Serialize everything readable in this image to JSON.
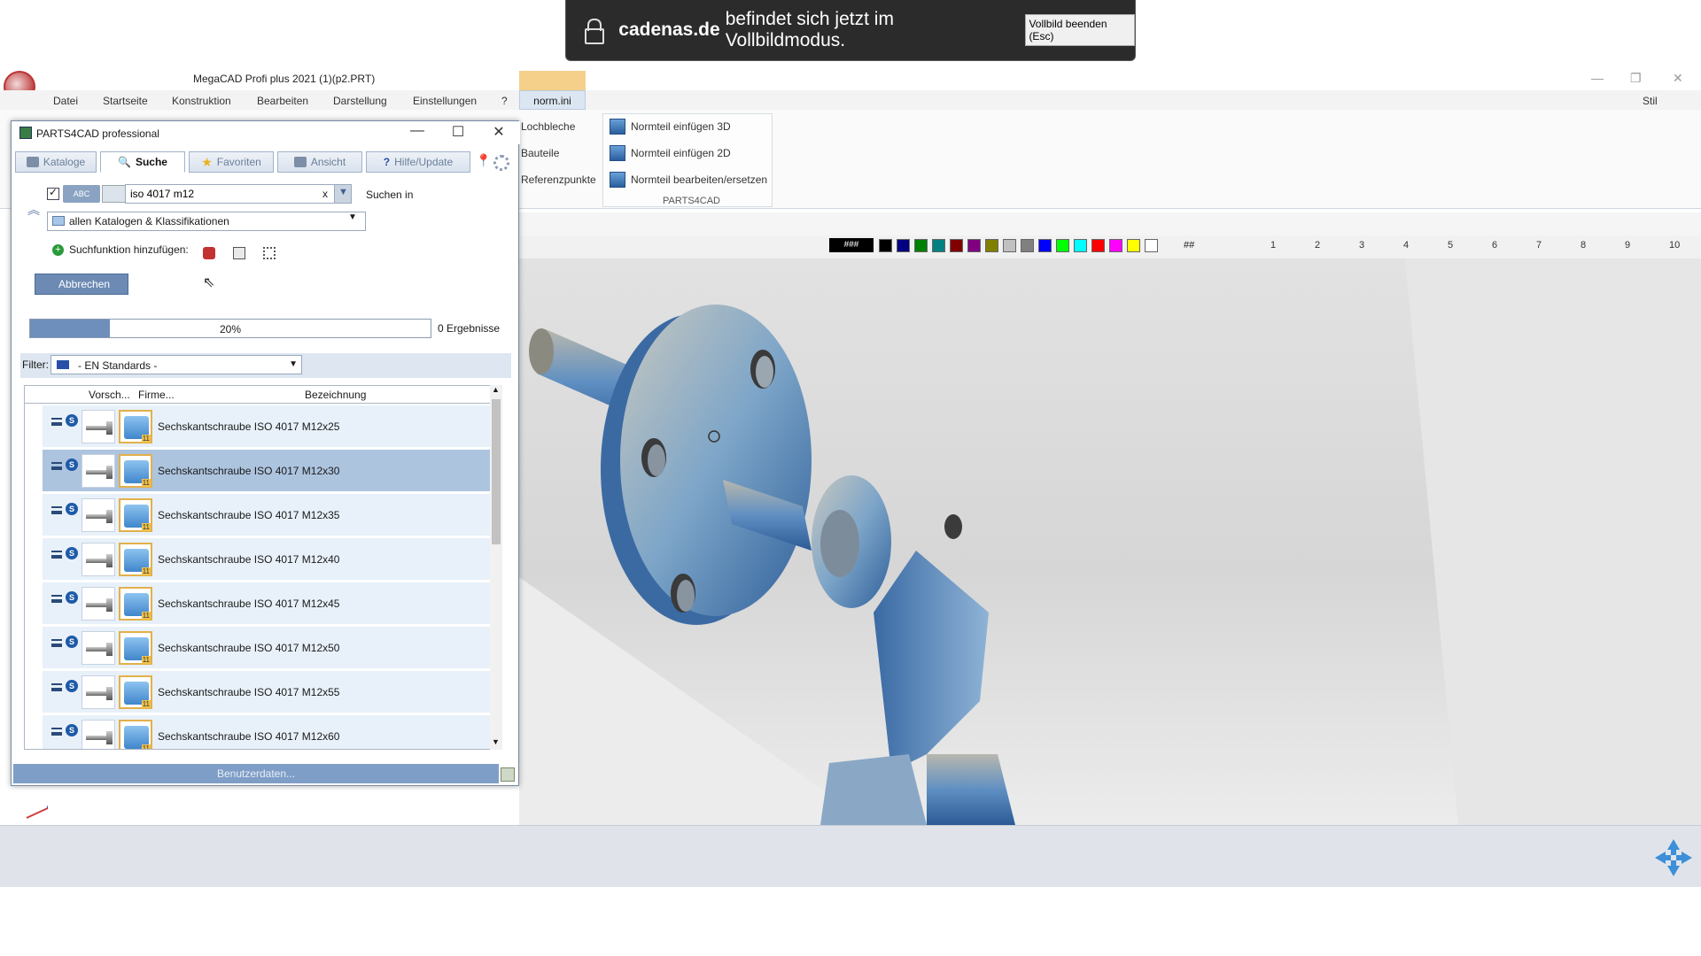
{
  "fullscreen_banner": {
    "domain": "cadenas.de",
    "message": "befindet sich jetzt im Vollbildmodus.",
    "exit_button": "Vollbild beenden (Esc)"
  },
  "app": {
    "title": "MegaCAD Profi plus 2021 (1)(p2.PRT)",
    "ribbon_tabs": [
      "Datei",
      "Startseite",
      "Konstruktion",
      "Bearbeiten",
      "Darstellung",
      "Einstellungen",
      "?",
      "norm.ini"
    ],
    "right_controls": {
      "stil": "Stil"
    },
    "ribbon_left_items": [
      "Lochbleche",
      "Bauteile",
      "Referenzpunkte"
    ],
    "parts4cad_group": {
      "items": [
        "Normteil einfügen 3D",
        "Normteil einfügen 2D",
        "Normteil bearbeiten/ersetzen"
      ],
      "group_label": "PARTS4CAD"
    },
    "toolbar_hash_label": "###",
    "toolbar_hash2": "##",
    "ruler": [
      "1",
      "2",
      "3",
      "4",
      "5",
      "6",
      "7",
      "8",
      "9",
      "10"
    ],
    "colors": [
      "#000000",
      "#000080",
      "#008000",
      "#008080",
      "#800000",
      "#800080",
      "#808000",
      "#c0c0c0",
      "#808080",
      "#0000ff",
      "#00ff00",
      "#00ffff",
      "#ff0000",
      "#ff00ff",
      "#ffff00",
      "#ffffff"
    ]
  },
  "parts4cad": {
    "title": "PARTS4CAD professional",
    "tabs": [
      "Kataloge",
      "Suche",
      "Favoriten",
      "Ansicht",
      "Hilfe/Update"
    ],
    "active_tab": "Suche",
    "abc_label": "ABC",
    "search_value": "iso 4017 m12",
    "search_clear": "x",
    "search_in_label": "Suchen in",
    "catalog_scope": "allen Katalogen & Klassifikationen",
    "add_function_label": "Suchfunktion hinzufügen:",
    "abort_button": "Abbrechen",
    "progress_label": "20%",
    "progress_fraction": 0.2,
    "results_label": "0 Ergebnisse",
    "filter_label": "Filter:",
    "filter_value": "- EN Standards -",
    "columns": [
      "Vorsch...",
      "Firme...",
      "Bezeichnung"
    ],
    "rows": [
      {
        "name": "Sechskantschraube ISO 4017 M12x25",
        "selected": false
      },
      {
        "name": "Sechskantschraube ISO 4017 M12x30",
        "selected": true
      },
      {
        "name": "Sechskantschraube ISO 4017 M12x35",
        "selected": false
      },
      {
        "name": "Sechskantschraube ISO 4017 M12x40",
        "selected": false
      },
      {
        "name": "Sechskantschraube ISO 4017 M12x45",
        "selected": false
      },
      {
        "name": "Sechskantschraube ISO 4017 M12x50",
        "selected": false
      },
      {
        "name": "Sechskantschraube ISO 4017 M12x55",
        "selected": false
      },
      {
        "name": "Sechskantschraube ISO 4017 M12x60",
        "selected": false
      }
    ],
    "footer_button": "Benutzerdaten..."
  }
}
